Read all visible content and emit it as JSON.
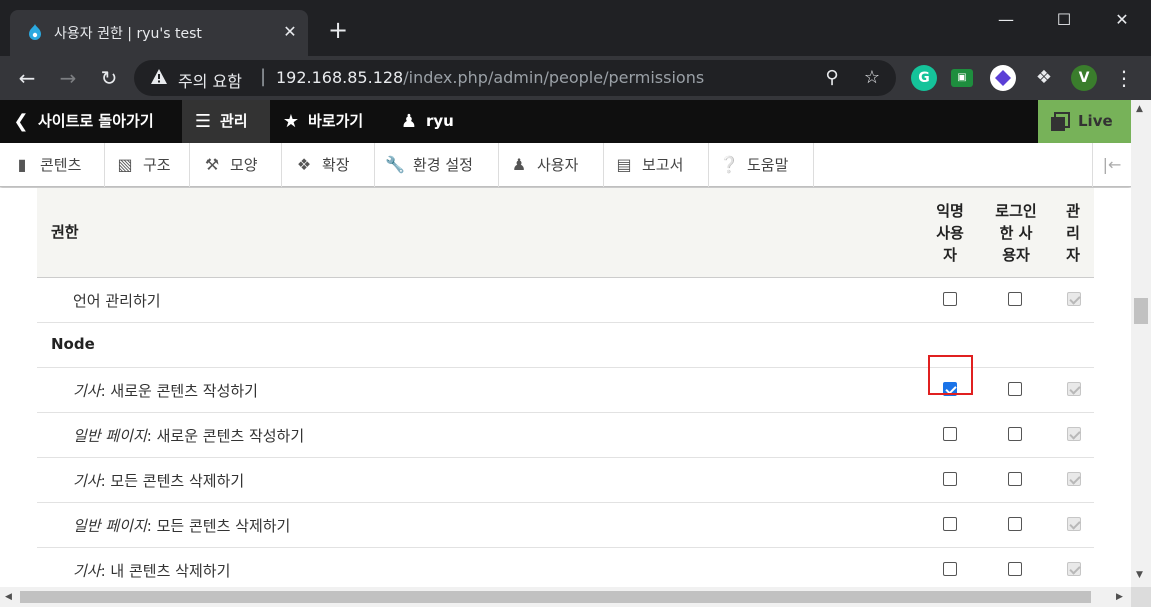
{
  "browser": {
    "tab_title": "사용자 권한 | ryu's test",
    "tab_close": "✕",
    "new_tab": "+",
    "window_controls": {
      "minimize": "—",
      "maximize": "☐",
      "close": "✕"
    },
    "security_warning": "주의 요함",
    "url_separator": "|",
    "url_host": "192.168.85.128",
    "url_path": "/index.php/admin/people/permissions",
    "profile_initial": "V",
    "grammarly_initial": "G",
    "icons": [
      "back-icon",
      "forward-icon",
      "reload-icon",
      "warning-icon",
      "zoom-icon",
      "star-icon",
      "grammarly-icon",
      "extension-icon",
      "gem-icon",
      "puzzle-icon",
      "menu-icon"
    ]
  },
  "drupal_toolbar": {
    "back_to_site": "사이트로 돌아가기",
    "manage": "관리",
    "shortcuts": "바로가기",
    "user": "ryu",
    "live": "Live"
  },
  "admin_tray": {
    "items": [
      "콘텐츠",
      "구조",
      "모양",
      "확장",
      "환경 설정",
      "사용자",
      "보고서",
      "도움말"
    ]
  },
  "table": {
    "header_permission": "권한",
    "roles": [
      [
        "익명",
        "사용",
        "자"
      ],
      [
        "로그인",
        "한 사",
        "용자"
      ],
      [
        "관",
        "리",
        "자"
      ]
    ],
    "rows": [
      {
        "type": "perm",
        "prefix": "",
        "text": "언어 관리하기",
        "anon": false,
        "auth": false,
        "admin": true
      },
      {
        "type": "group",
        "text": "Node"
      },
      {
        "type": "perm",
        "prefix": "기사",
        "text": ": 새로운 콘텐츠 작성하기",
        "anon": true,
        "auth": false,
        "admin": true
      },
      {
        "type": "perm",
        "prefix": "일반 페이지",
        "text": ": 새로운 콘텐츠 작성하기",
        "anon": false,
        "auth": false,
        "admin": true
      },
      {
        "type": "perm",
        "prefix": "기사",
        "text": ": 모든 콘텐츠 삭제하기",
        "anon": false,
        "auth": false,
        "admin": true
      },
      {
        "type": "perm",
        "prefix": "일반 페이지",
        "text": ": 모든 콘텐츠 삭제하기",
        "anon": false,
        "auth": false,
        "admin": true
      },
      {
        "type": "perm",
        "prefix": "기사",
        "text": ": 내 콘텐츠 삭제하기",
        "anon": false,
        "auth": false,
        "admin": true
      }
    ]
  },
  "colors": {
    "tray_bg": "#0f0f0f",
    "live_green": "#77b259",
    "checkbox_blue": "#1a73e8",
    "highlight_red": "#e02020"
  }
}
